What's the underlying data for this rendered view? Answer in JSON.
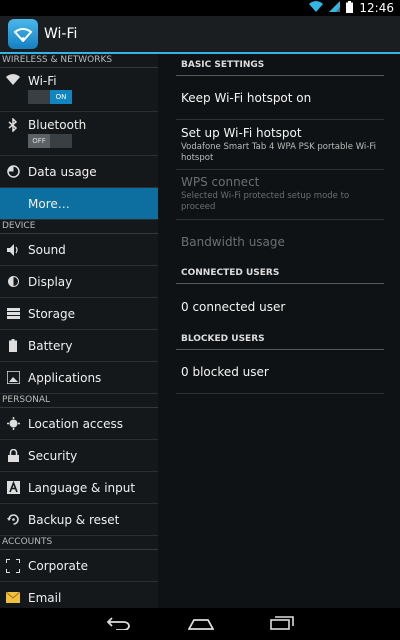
{
  "status": {
    "time": "12:46"
  },
  "actionbar": {
    "title": "Wi-Fi",
    "icon": "wifi-settings-icon"
  },
  "sidebar": {
    "sections": {
      "wireless": "WIRELESS & NETWORKS",
      "device": "DEVICE",
      "personal": "PERSONAL",
      "accounts": "ACCOUNTS"
    },
    "wifi": {
      "label": "Wi-Fi",
      "toggle": "ON"
    },
    "bluetooth": {
      "label": "Bluetooth",
      "toggle": "OFF"
    },
    "data_usage": "Data usage",
    "more": "More…",
    "sound": "Sound",
    "display": "Display",
    "storage": "Storage",
    "battery": "Battery",
    "applications": "Applications",
    "location": "Location access",
    "security": "Security",
    "language": "Language & input",
    "backup": "Backup & reset",
    "corporate": "Corporate",
    "email": "Email"
  },
  "content": {
    "basic_settings": "BASIC SETTINGS",
    "keep_hotspot": "Keep Wi-Fi hotspot on",
    "setup_hotspot": {
      "title": "Set up Wi-Fi hotspot",
      "summary": "Vodafone Smart  Tab 4 WPA PSK portable Wi-Fi hotspot"
    },
    "wps": {
      "title": "WPS connect",
      "summary": "Selected Wi-Fi protected setup mode to proceed"
    },
    "bandwidth": "Bandwidth usage",
    "connected_users": "CONNECTED USERS",
    "connected_count": "0 connected user",
    "blocked_users": "BLOCKED USERS",
    "blocked_count": "0 blocked user"
  },
  "colors": {
    "accent": "#33b5e5",
    "selected": "#0d6fa0"
  }
}
